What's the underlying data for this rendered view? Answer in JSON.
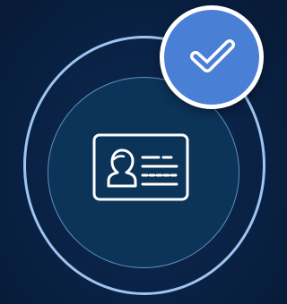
{
  "icons": {
    "id_card": "id-card-icon",
    "check": "checkmark-icon"
  },
  "status": {
    "verified": true
  },
  "colors": {
    "background": "#0a2347",
    "ring": "#9fc4f0",
    "disc": "#0c3358",
    "badge_fill": "#4a7fd6",
    "badge_border": "#ffffff",
    "icon_stroke": "#ffffff"
  }
}
